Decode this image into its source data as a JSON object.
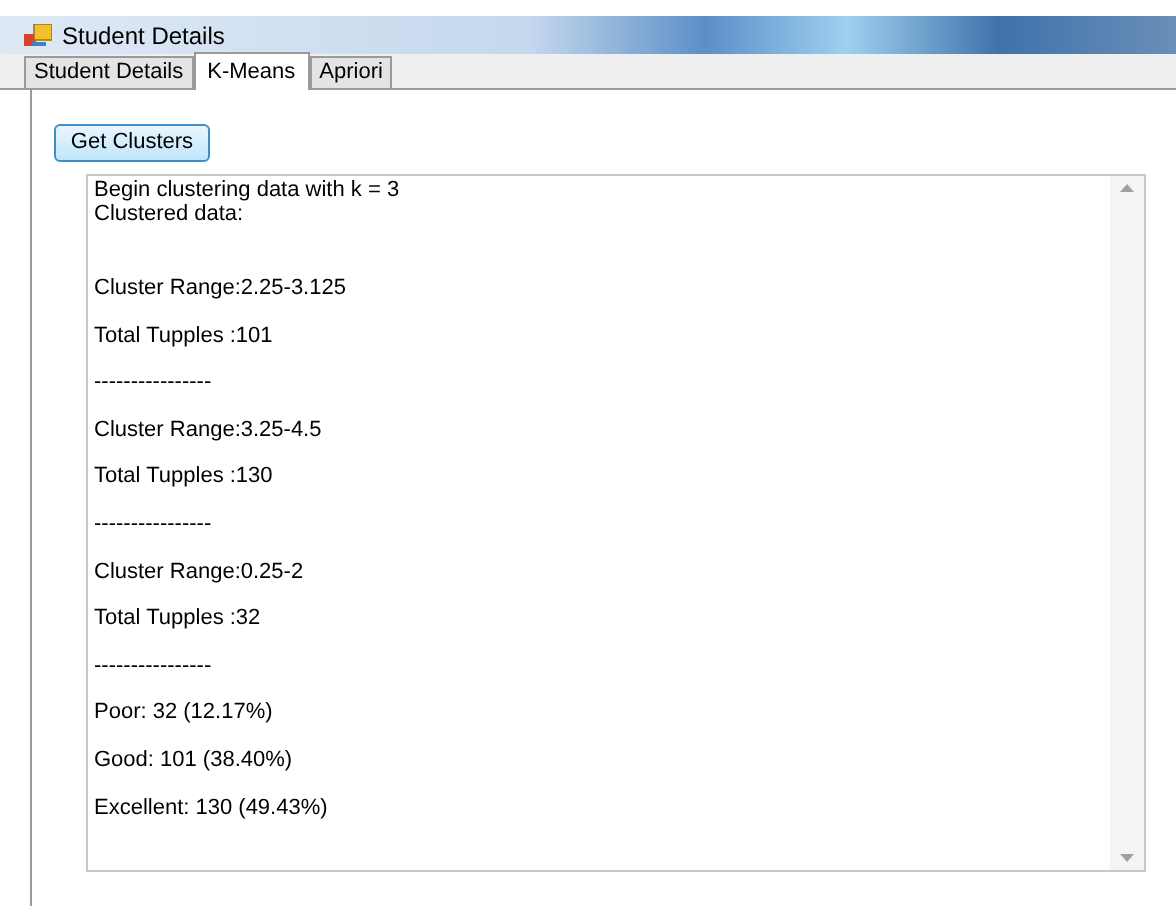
{
  "window": {
    "title": "Student Details"
  },
  "tabs": [
    {
      "label": "Student Details",
      "selected": false
    },
    {
      "label": "K-Means",
      "selected": true
    },
    {
      "label": "Apriori",
      "selected": false
    }
  ],
  "button": {
    "label": "Get Clusters"
  },
  "output": {
    "header": [
      "Begin clustering data with k = 3",
      "Clustered data:"
    ],
    "lines": [
      "Cluster Range:2.25-3.125",
      "Total Tupples :101",
      "----------------",
      "Cluster Range:3.25-4.5",
      "Total Tupples :130",
      "----------------",
      "Cluster Range:0.25-2",
      "Total Tupples :32",
      "----------------",
      "Poor: 32 (12.17%)",
      "Good: 101 (38.40%)",
      "Excellent: 130 (49.43%)"
    ]
  }
}
